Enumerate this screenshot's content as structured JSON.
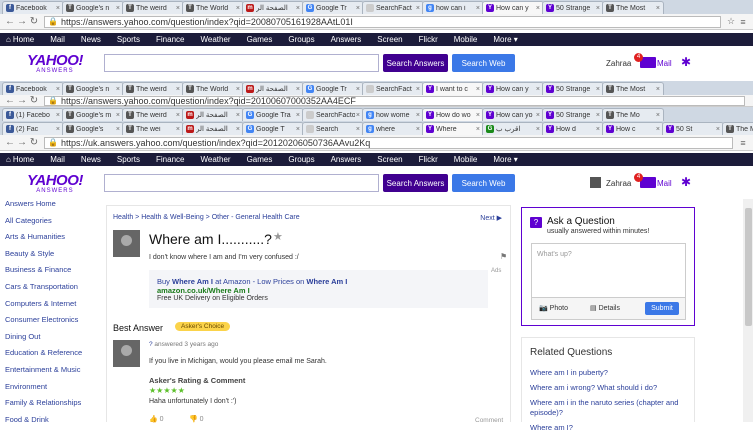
{
  "browser_layers": [
    {
      "tabs": [
        {
          "label": "Facebook",
          "fav": "f",
          "color": "#3b5998"
        },
        {
          "label": "Google's n",
          "fav": "T",
          "color": "#555555"
        },
        {
          "label": "The weird",
          "fav": "T",
          "color": "#555555"
        },
        {
          "label": "The World",
          "fav": "T",
          "color": "#555555"
        },
        {
          "label": "الصفحة الر",
          "fav": "m",
          "color": "#bb1919"
        },
        {
          "label": "Google Tr",
          "fav": "G",
          "color": "#4285f4"
        },
        {
          "label": "SearchFact",
          "fav": "",
          "color": "#cccccc"
        },
        {
          "label": "how can i",
          "fav": "g",
          "color": "#4285f4"
        },
        {
          "label": "How can y",
          "fav": "Y",
          "color": "#5f01d1",
          "active": true
        },
        {
          "label": "50 Strange",
          "fav": "Y",
          "color": "#5f01d1"
        },
        {
          "label": "The Most",
          "fav": "T",
          "color": "#555555"
        }
      ],
      "url": "https://answers.yahoo.com/question/index?qid=20080705161928AAtL01I"
    },
    {
      "tabs": [
        {
          "label": "Facebook",
          "fav": "f",
          "color": "#3b5998"
        },
        {
          "label": "Google's n",
          "fav": "T",
          "color": "#555555"
        },
        {
          "label": "The weird",
          "fav": "T",
          "color": "#555555"
        },
        {
          "label": "The World",
          "fav": "T",
          "color": "#555555"
        },
        {
          "label": "الصفحة الر",
          "fav": "m",
          "color": "#bb1919"
        },
        {
          "label": "Google Tr",
          "fav": "G",
          "color": "#4285f4"
        },
        {
          "label": "SearchFact",
          "fav": "",
          "color": "#cccccc"
        },
        {
          "label": "I want to c",
          "fav": "Y",
          "color": "#5f01d1",
          "active": true
        },
        {
          "label": "How can y",
          "fav": "Y",
          "color": "#5f01d1"
        },
        {
          "label": "50 Strange",
          "fav": "Y",
          "color": "#5f01d1"
        },
        {
          "label": "The Most",
          "fav": "T",
          "color": "#555555"
        }
      ],
      "url": "https://answers.yahoo.com/question/index?qid=20100607000352AA4ECF"
    },
    {
      "tabs": [
        {
          "label": "(1) Facebo",
          "fav": "f",
          "color": "#3b5998"
        },
        {
          "label": "Google's m",
          "fav": "T",
          "color": "#555555"
        },
        {
          "label": "The weird",
          "fav": "T",
          "color": "#555555"
        },
        {
          "label": "الصفحة الر",
          "fav": "m",
          "color": "#bb1919"
        },
        {
          "label": "Google Tra",
          "fav": "G",
          "color": "#4285f4"
        },
        {
          "label": "SearchFacto",
          "fav": "",
          "color": "#cccccc"
        },
        {
          "label": "how wome",
          "fav": "g",
          "color": "#4285f4"
        },
        {
          "label": "How do wo",
          "fav": "Y",
          "color": "#5f01d1",
          "active": true
        },
        {
          "label": "How can yo",
          "fav": "Y",
          "color": "#5f01d1"
        },
        {
          "label": "50 Strange",
          "fav": "Y",
          "color": "#5f01d1"
        },
        {
          "label": "The Mo",
          "fav": "T",
          "color": "#555555"
        }
      ]
    },
    {
      "tabs": [
        {
          "label": "(2) Fac",
          "fav": "f",
          "color": "#3b5998"
        },
        {
          "label": "Google's",
          "fav": "T",
          "color": "#555555"
        },
        {
          "label": "The wei",
          "fav": "T",
          "color": "#555555"
        },
        {
          "label": "الصفحة الر",
          "fav": "m",
          "color": "#bb1919"
        },
        {
          "label": "Google T",
          "fav": "G",
          "color": "#4285f4"
        },
        {
          "label": "Search",
          "fav": "",
          "color": "#cccccc"
        },
        {
          "label": "where",
          "fav": "g",
          "color": "#4285f4"
        },
        {
          "label": "Where",
          "fav": "Y",
          "color": "#5f01d1",
          "active": true
        },
        {
          "label": "اقرب ب",
          "fav": "G",
          "color": "#1a8a1a"
        },
        {
          "label": "How d",
          "fav": "Y",
          "color": "#5f01d1"
        },
        {
          "label": "How c",
          "fav": "Y",
          "color": "#5f01d1"
        },
        {
          "label": "50 St",
          "fav": "Y",
          "color": "#5f01d1"
        },
        {
          "label": "The M",
          "fav": "T",
          "color": "#555555"
        }
      ],
      "url": "https://uk.answers.yahoo.com/question/index?qid=20120206050736AAvu2Kq"
    }
  ],
  "nav": {
    "items": [
      "Home",
      "Mail",
      "News",
      "Sports",
      "Finance",
      "Weather",
      "Games",
      "Groups",
      "Answers",
      "Screen",
      "Flickr",
      "Mobile",
      "More ▾"
    ]
  },
  "header": {
    "logo_top": "YAHOO!",
    "logo_bottom": "ANSWERS",
    "search_answers": "Search Answers",
    "search_web": "Search Web",
    "user": "Zahraa",
    "mail_count": "4",
    "mail_label": "Mail"
  },
  "sidebar": {
    "items": [
      "Answers Home",
      "All Categories",
      "Arts & Humanities",
      "Beauty & Style",
      "Business & Finance",
      "Cars & Transportation",
      "Computers & Internet",
      "Consumer Electronics",
      "Dining Out",
      "Education & Reference",
      "Entertainment & Music",
      "Environment",
      "Family & Relationships",
      "Food & Drink"
    ]
  },
  "question": {
    "breadcrumb": "Health > Health & Well-Being > Other - General Health Care",
    "next": "Next ▶",
    "title": "Where am I...........?",
    "detail": "I don't know where I am and I'm very confused :/",
    "ads_label": "Ads",
    "ad": {
      "line1_pre": "Buy ",
      "line1_b1": "Where Am I",
      "line1_mid": " at Amazon - Low Prices on ",
      "line1_b2": "Where Am I",
      "line2": "amazon.co.uk/Where Am I",
      "line3": "Free UK Delivery on Eligible Orders"
    }
  },
  "best_answer": {
    "heading": "Best Answer",
    "badge": "Asker's Choice",
    "answerer_q": "?",
    "answered": " answered 3 years ago",
    "text": "If you live in Michigan, would you please email me Sarah.",
    "rating_heading": "Asker's Rating & Comment",
    "stars": "★★★★★",
    "comment": "Haha unfortunately I don't :')",
    "up_count": "0",
    "down_count": "0",
    "comment_link": "Comment"
  },
  "ask": {
    "title": "Ask a Question",
    "subtitle": "usually answered within minutes!",
    "placeholder": "What's up?",
    "photo": "Photo",
    "details": "Details",
    "submit": "Submit"
  },
  "related": {
    "title": "Related Questions",
    "items": [
      "Where am I in puberty?",
      "Where am i wrong? What should i do?",
      "Where am i in the naruto series (chapter and episode)?",
      "Where am I?"
    ]
  }
}
